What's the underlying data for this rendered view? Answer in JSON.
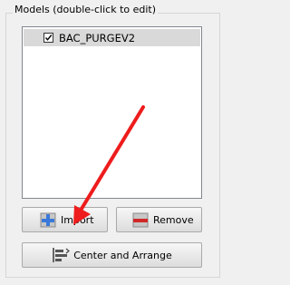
{
  "group": {
    "title": "Models (double-click to edit)"
  },
  "models_list": {
    "items": [
      {
        "label": "BAC_PURGEV2",
        "checked": true
      }
    ]
  },
  "buttons": {
    "import_label": "Import",
    "remove_label": "Remove",
    "center_label": "Center and Arrange"
  },
  "icons": {
    "import": "plus-icon",
    "remove": "minus-icon",
    "center": "arrange-icon",
    "annotation": "red-arrow"
  },
  "colors": {
    "selection_bg": "#d9d9d9",
    "import_plus": "#3b79d9",
    "remove_minus": "#d02828",
    "annotation_arrow": "#ee1c1c"
  }
}
